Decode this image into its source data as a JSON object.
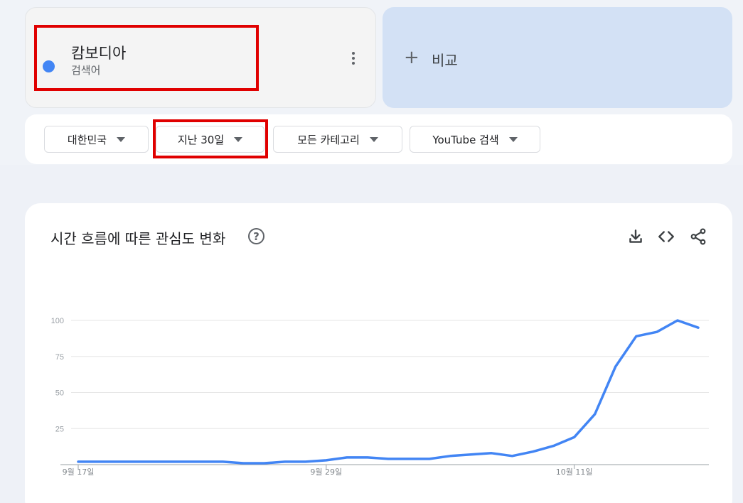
{
  "term": {
    "name": "캄보디아",
    "type": "검색어",
    "color": "#4285f4"
  },
  "compare": {
    "label": "비교",
    "icon": "plus-icon"
  },
  "filters": [
    {
      "label": "대한민국",
      "icon": "caret-down-icon"
    },
    {
      "label": "지난 30일",
      "icon": "caret-down-icon"
    },
    {
      "label": "모든 카테고리",
      "icon": "caret-down-icon"
    },
    {
      "label": "YouTube 검색",
      "icon": "caret-down-icon"
    }
  ],
  "chart_section": {
    "title": "시간 흐름에 따른 관심도 변화",
    "help_icon": "help-circle-icon",
    "actions": [
      "download-icon",
      "embed-code-icon",
      "share-icon"
    ]
  },
  "chart_data": {
    "type": "line",
    "title": "",
    "xlabel": "",
    "ylabel": "",
    "ylim": [
      0,
      100
    ],
    "y_ticks": [
      25,
      50,
      75,
      100
    ],
    "x_ticks": [
      {
        "label": "9월 17일",
        "index": 0
      },
      {
        "label": "9월 29일",
        "index": 12
      },
      {
        "label": "10월 11일",
        "index": 24
      }
    ],
    "grid": true,
    "series": [
      {
        "color": "#4285f4",
        "values": [
          2,
          2,
          2,
          2,
          2,
          2,
          2,
          2,
          1,
          1,
          2,
          2,
          3,
          5,
          5,
          4,
          4,
          4,
          6,
          7,
          8,
          6,
          9,
          13,
          19,
          35,
          68,
          89,
          92,
          100,
          95
        ]
      }
    ]
  },
  "colors": {
    "highlight": "#e00000",
    "accent": "#4285f4"
  }
}
